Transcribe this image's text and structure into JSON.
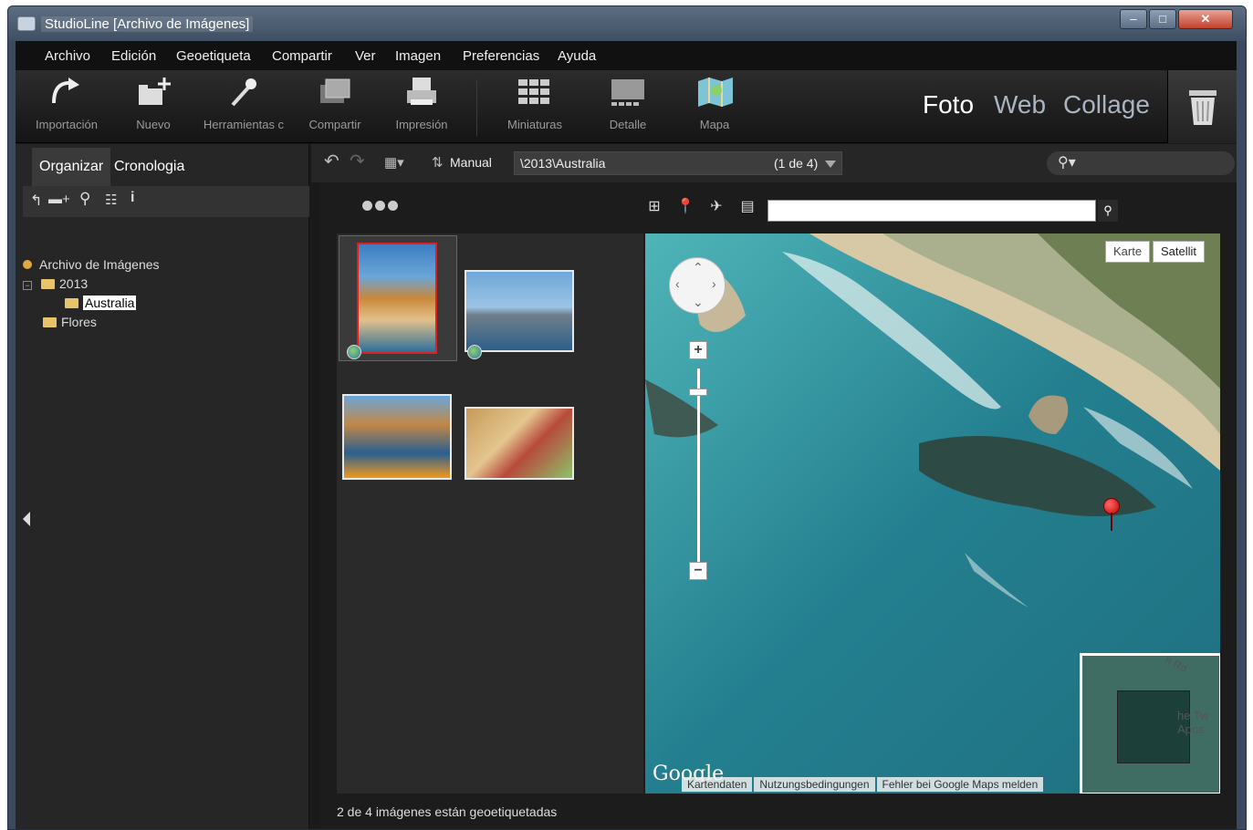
{
  "window": {
    "title": "StudioLine [Archivo de Imágenes]"
  },
  "menu": [
    "Archivo",
    "Edición",
    "Geoetiqueta",
    "Compartir",
    "Ver",
    "Imagen",
    "Preferencias",
    "Ayuda"
  ],
  "toolbar": {
    "tools": [
      "Importación",
      "Nuevo",
      "Herramientas c",
      "Compartir",
      "Impresión",
      "Miniaturas",
      "Detalle",
      "Mapa"
    ],
    "modes": {
      "foto": "Foto",
      "web": "Web",
      "collage": "Collage"
    }
  },
  "left_panel": {
    "tabs": {
      "organize": "Organizar",
      "timeline": "Cronologia"
    },
    "tree": {
      "root": "Archivo de Imágenes",
      "year": "2013",
      "selected": "Australia",
      "flores": "Flores"
    }
  },
  "path_bar": {
    "sort": "Manual",
    "path": "\\2013\\Australia",
    "count": "(1 de 4)"
  },
  "map": {
    "types": {
      "karte": "Karte",
      "satellit": "Satellit"
    },
    "zoom_in": "+",
    "zoom_out": "−",
    "overview_road": "n Rd",
    "overview_place": "he Tw\nApos",
    "google_mark": "Google",
    "footer": {
      "data": "Kartendaten",
      "terms": "Nutzungsbedingungen",
      "report": "Fehler bei Google Maps melden"
    }
  },
  "status": "2 de 4 imágenes están geoetiquetadas"
}
